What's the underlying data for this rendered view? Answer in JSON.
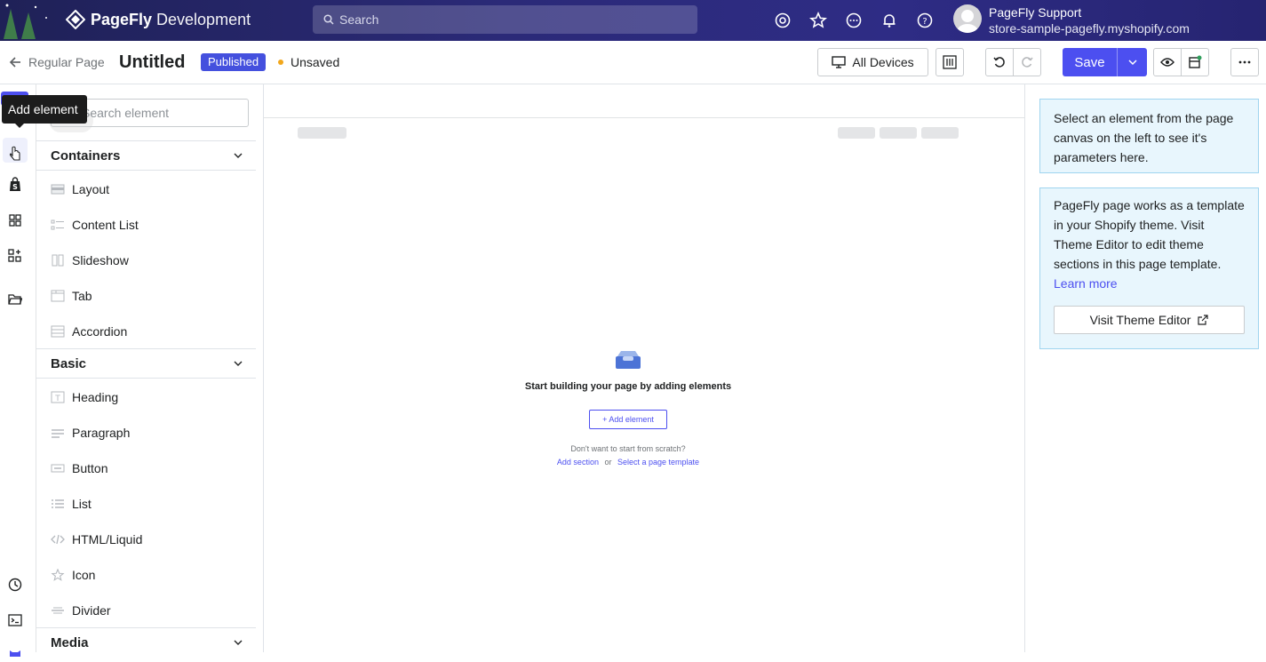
{
  "topbar": {
    "brand": "PageFly",
    "environment": "Development",
    "search_placeholder": "Search",
    "icons": [
      "settings-icon",
      "star-icon",
      "chat-icon",
      "bell-icon",
      "help-icon"
    ],
    "user": {
      "name": "PageFly Support",
      "store": "store-sample-pagefly.myshopify.com"
    }
  },
  "toolbar": {
    "back_label": "Regular Page",
    "page_title": "Untitled",
    "status_badge": "Published",
    "save_state": "Unsaved",
    "devices_label": "All Devices",
    "save_label": "Save"
  },
  "rail": {
    "tooltip": "Add element",
    "icons": [
      "add-element-icon",
      "cursor-icon",
      "shopify-bag-icon",
      "grid-icon",
      "widgets-icon",
      "folder-icon",
      "history-icon",
      "console-icon"
    ]
  },
  "panel": {
    "search_placeholder": "Search element",
    "sections": [
      {
        "title": "Containers",
        "items": [
          "Layout",
          "Content List",
          "Slideshow",
          "Tab",
          "Accordion"
        ]
      },
      {
        "title": "Basic",
        "items": [
          "Heading",
          "Paragraph",
          "Button",
          "List",
          "HTML/Liquid",
          "Icon",
          "Divider"
        ]
      },
      {
        "title": "Media",
        "items": []
      }
    ]
  },
  "canvas": {
    "empty_heading": "Start building your page by adding elements",
    "add_element_label": "+ Add element",
    "scratch_text": "Don't want to start from scratch?",
    "add_section_link": "Add section",
    "or_text": "or",
    "template_link": "Select a page template"
  },
  "right_panel": {
    "info_text": "Select an element from the page canvas on the left to see it's parameters here.",
    "theme_text": "PageFly page works as a template in your Shopify theme. Visit Theme Editor to edit theme sections in this page template.",
    "learn_more": "Learn more",
    "visit_button": "Visit Theme Editor"
  },
  "colors": {
    "accent": "#4c4ff0",
    "topbar": "#2b2a78",
    "info_bg": "#e8f6fd"
  }
}
